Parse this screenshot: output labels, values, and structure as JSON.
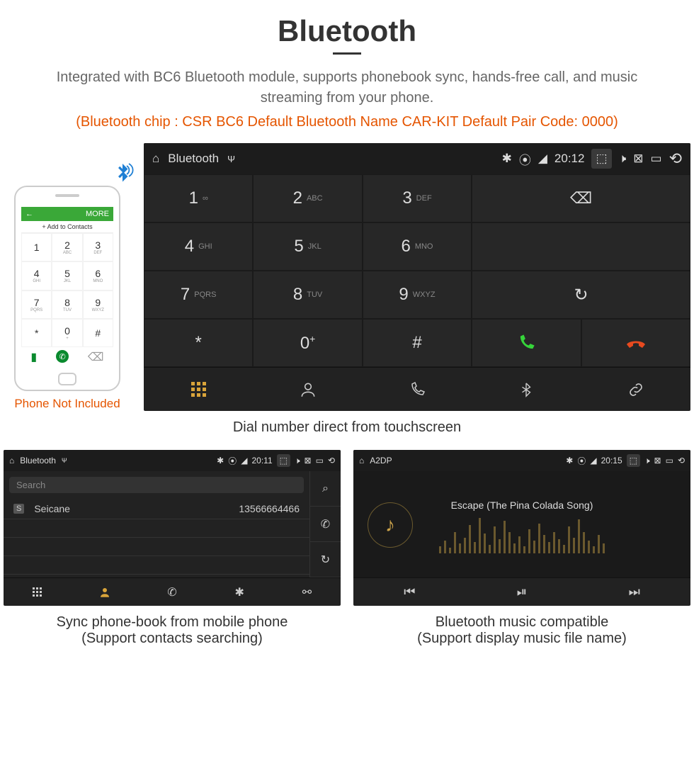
{
  "header": {
    "title": "Bluetooth",
    "subtitle": "Integrated with BC6 Bluetooth module, supports phonebook sync, hands-free call, and music streaming from your phone.",
    "spec": "(Bluetooth chip : CSR BC6    Default Bluetooth Name CAR-KIT    Default Pair Code: 0000)"
  },
  "phone": {
    "menu_left": "←",
    "menu_right": "MORE",
    "contacts_label": "+  Add to Contacts",
    "note": "Phone Not Included",
    "keys": [
      "1",
      "2",
      "3",
      "4",
      "5",
      "6",
      "7",
      "8",
      "9",
      "*",
      "0",
      "#"
    ],
    "subs": [
      "",
      "ABC",
      "DEF",
      "GHI",
      "JKL",
      "MNO",
      "PQRS",
      "TUV",
      "WXYZ",
      "",
      "+",
      ""
    ]
  },
  "dialer": {
    "status": {
      "title": "Bluetooth",
      "time": "20:12"
    },
    "keys": [
      {
        "n": "1",
        "l": "∞"
      },
      {
        "n": "2",
        "l": "ABC"
      },
      {
        "n": "3",
        "l": "DEF"
      },
      {
        "n": "4",
        "l": "GHI"
      },
      {
        "n": "5",
        "l": "JKL"
      },
      {
        "n": "6",
        "l": "MNO"
      },
      {
        "n": "7",
        "l": "PQRS"
      },
      {
        "n": "8",
        "l": "TUV"
      },
      {
        "n": "9",
        "l": "WXYZ"
      },
      {
        "n": "*",
        "l": ""
      },
      {
        "n": "0",
        "l": "+"
      },
      {
        "n": "#",
        "l": ""
      }
    ],
    "caption": "Dial number direct from touchscreen"
  },
  "contacts": {
    "status": {
      "title": "Bluetooth",
      "time": "20:11"
    },
    "search_placeholder": "Search",
    "badge": "S",
    "name": "Seicane",
    "number": "13566664466",
    "caption_line1": "Sync phone-book from mobile phone",
    "caption_line2": "(Support contacts searching)"
  },
  "music": {
    "status": {
      "title": "A2DP",
      "time": "20:15"
    },
    "song": "Escape (The Pina Colada Song)",
    "caption_line1": "Bluetooth music compatible",
    "caption_line2": "(Support display music file name)"
  },
  "eq_heights": [
    10,
    18,
    8,
    30,
    14,
    22,
    40,
    16,
    50,
    28,
    12,
    38,
    20,
    46,
    30,
    14,
    24,
    10,
    34,
    18,
    42,
    26,
    16,
    30,
    20,
    12,
    38,
    22,
    48,
    30,
    18,
    10,
    26,
    14
  ]
}
